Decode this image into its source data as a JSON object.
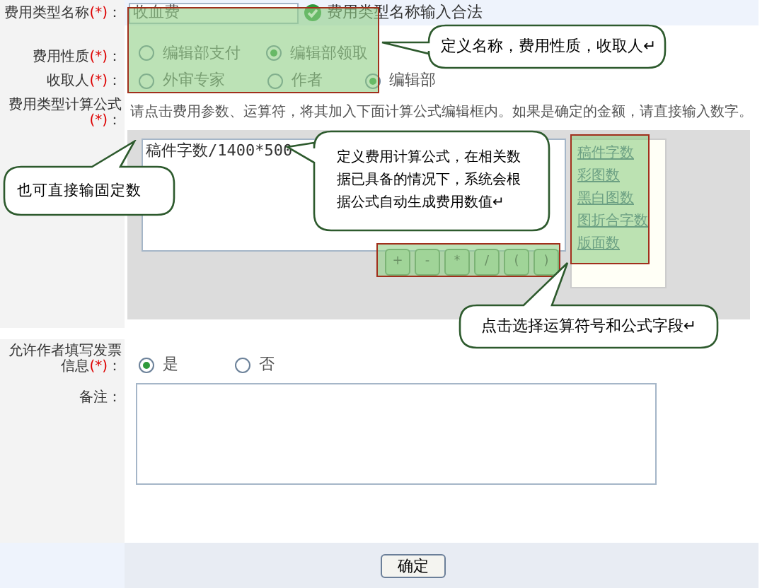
{
  "rows": [
    {
      "kind": "text",
      "label": "费用类型名称",
      "mark": "(*)",
      "colon": "：",
      "value": "收血费",
      "status": "费用类型名称输入合法"
    },
    {
      "kind": "radio",
      "label": "费用性质",
      "mark": "(*)",
      "colon": "：",
      "options": [
        {
          "label": "编辑部支付",
          "selected": false
        },
        {
          "label": "编辑部领取",
          "selected": true
        }
      ]
    },
    {
      "kind": "radio",
      "label": "收取人",
      "mark": "(*)",
      "colon": "：",
      "options": [
        {
          "label": "外审专家",
          "selected": false
        },
        {
          "label": "作者",
          "selected": false
        },
        {
          "label": "编辑部",
          "selected": true
        }
      ]
    },
    {
      "kind": "formula",
      "label": "费用类型计算公式",
      "mark": "(*)",
      "colon": "：",
      "hint": "请点击费用参数、运算符，将其加入下面计算公式编辑框内。如果是确定的金额，请直接输入数字。",
      "value": "稿件字数/1400*500",
      "operators": [
        "+",
        "-",
        "*",
        "/",
        "(",
        ")"
      ],
      "fields": [
        "稿件字数",
        "彩图数",
        "黑白图数",
        "图折合字数",
        "版面数"
      ]
    },
    {
      "kind": "radio",
      "label": "允许作者填写发票信息",
      "mark": "(*)",
      "colon": "：",
      "options": [
        {
          "label": "是",
          "selected": true
        },
        {
          "label": "否",
          "selected": false
        }
      ]
    },
    {
      "kind": "textarea",
      "label": "备注",
      "colon": "："
    }
  ],
  "submit": "确定",
  "callouts": [
    {
      "text": "定义名称，费用性质，收取人↵"
    },
    {
      "text": "也可直接输固定数"
    },
    {
      "text": "定义费用计算公式，在相关数据已具备的情况下，系统会根据公式自动生成费用数值↵"
    },
    {
      "text": "点击选择运算符号和公式字段↵"
    }
  ]
}
